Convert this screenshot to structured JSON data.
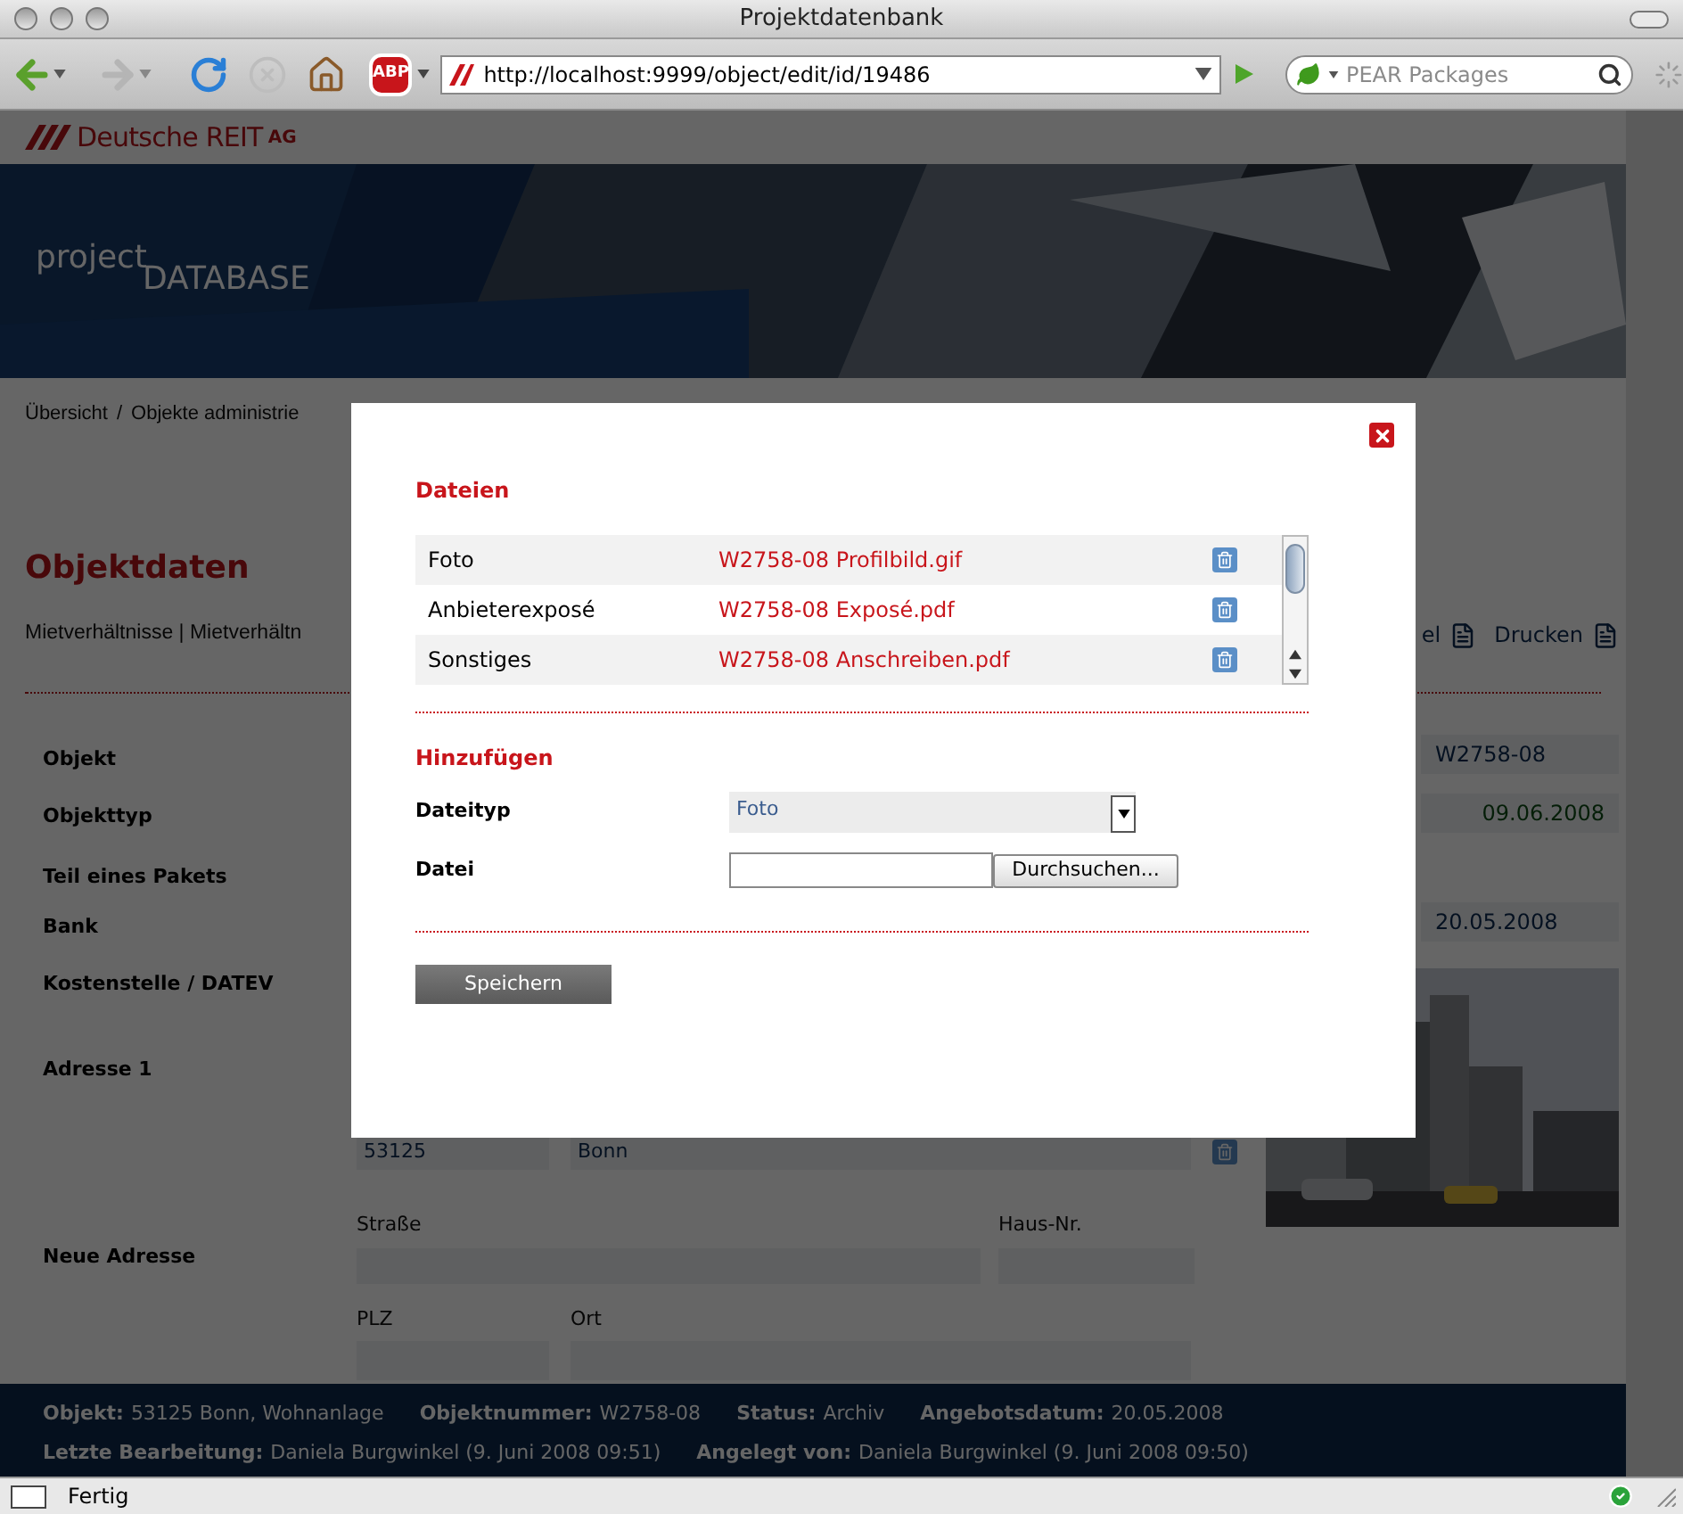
{
  "window": {
    "title": "Projektdatenbank"
  },
  "toolbar": {
    "abp_label": "ABP",
    "url": "http://localhost:9999/object/edit/id/19486",
    "search": {
      "placeholder": "PEAR Packages"
    }
  },
  "header": {
    "logo_name": "Deutsche REIT",
    "logo_suffix": "AG",
    "banner_line1": "project",
    "banner_line2": "DATABASE"
  },
  "breadcrumb": {
    "items": [
      "Übersicht",
      "Objekte administrie"
    ],
    "separator": "/"
  },
  "page_title": "Objektdaten",
  "subnav": {
    "tabs": "Mietverhältnisse | Mietverhältn",
    "actions": [
      "el",
      "Drucken"
    ]
  },
  "form": {
    "labels": [
      "Objekt",
      "Objekttyp",
      "Teil eines Pakets",
      "Bank",
      "Kostenstelle / DATEV",
      "Adresse 1",
      "Neue Adresse"
    ],
    "plz": "53125",
    "ort": "Bonn",
    "new_address_labels": [
      "Straße",
      "Haus-Nr.",
      "PLZ",
      "Ort"
    ]
  },
  "side_fields": [
    {
      "value": "W2758-08",
      "kind": "text"
    },
    {
      "value": "09.06.2008",
      "kind": "date"
    },
    {
      "value": "20.05.2008",
      "kind": "text"
    }
  ],
  "footer": {
    "lines": [
      [
        {
          "label": "Objekt:",
          "value": "53125 Bonn, Wohnanlage"
        },
        {
          "label": "Objektnummer:",
          "value": "W2758-08"
        },
        {
          "label": "Status:",
          "value": "Archiv"
        },
        {
          "label": "Angebotsdatum:",
          "value": "20.05.2008"
        }
      ],
      [
        {
          "label": "Letzte Bearbeitung:",
          "value": "Daniela Burgwinkel (9. Juni 2008 09:51)"
        },
        {
          "label": "Angelegt von:",
          "value": "Daniela Burgwinkel (9. Juni 2008 09:50)"
        }
      ]
    ]
  },
  "status_bar": {
    "text": "Fertig"
  },
  "dialog": {
    "files_heading": "Dateien",
    "files": [
      {
        "type": "Foto",
        "name": "W2758-08 Profilbild.gif"
      },
      {
        "type": "Anbieterexposé",
        "name": "W2758-08 Exposé.pdf"
      },
      {
        "type": "Sonstiges",
        "name": "W2758-08 Anschreiben.pdf"
      }
    ],
    "add_heading": "Hinzufügen",
    "file_type": {
      "label": "Dateityp",
      "value": "Foto"
    },
    "file": {
      "label": "Datei",
      "button": "Durchsuchen..."
    },
    "save": "Speichern"
  }
}
